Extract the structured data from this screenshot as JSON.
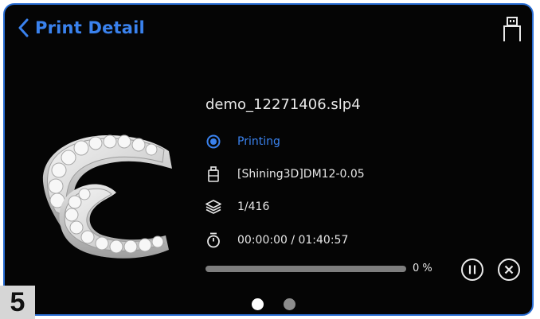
{
  "header": {
    "title": "Print Detail",
    "back_icon": "chevron-left-icon",
    "usb_icon": "usb-drive-icon"
  },
  "job": {
    "file_name": "demo_12271406.slp4",
    "status": "Printing",
    "resin": "[Shining3D]DM12-0.05",
    "layers": "1/416",
    "time": "00:00:00 / 01:40:57"
  },
  "progress": {
    "percent": 0,
    "label": "0 %"
  },
  "controls": {
    "pause_icon": "pause-circle-icon",
    "stop_icon": "close-circle-icon"
  },
  "pager": {
    "pages": 2,
    "active": 1
  },
  "step_badge": "5",
  "colors": {
    "accent": "#3a82ee",
    "border": "#2a6fd6",
    "background": "#050505",
    "text": "#e6e6e6"
  }
}
